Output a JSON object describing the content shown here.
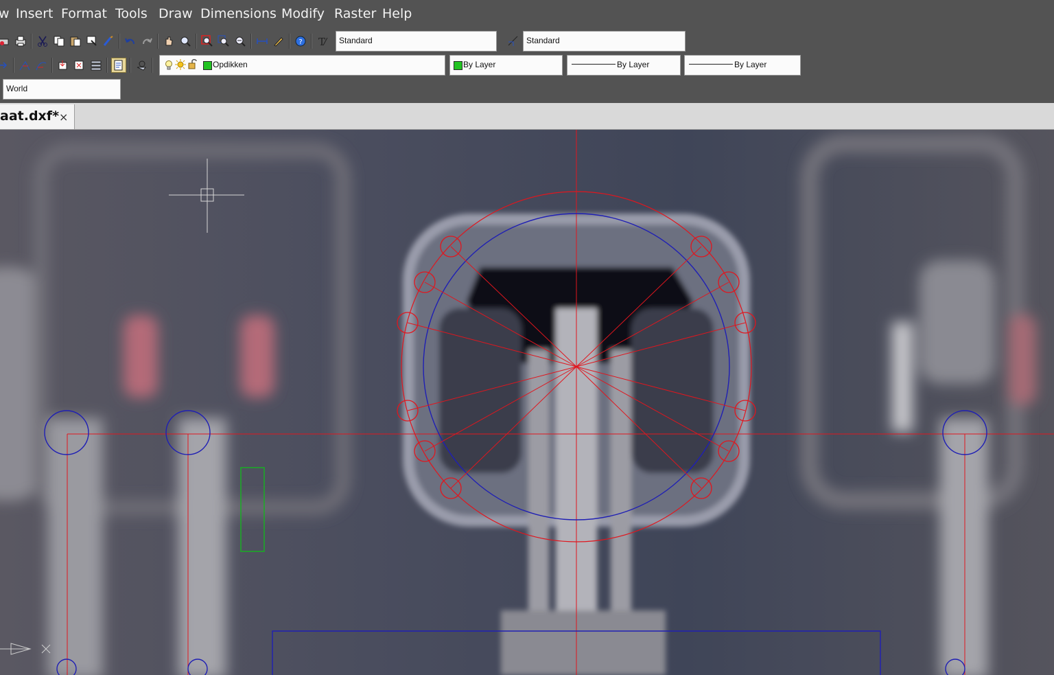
{
  "menu": {
    "items": [
      "w",
      "Insert",
      "Format",
      "Tools",
      "Draw",
      "Dimensions",
      "Modify",
      "Raster",
      "Help"
    ]
  },
  "toolbar": {
    "text_style": "Standard",
    "dim_style": "Standard",
    "layer": "Opdikken",
    "color": "By Layer",
    "linetype": "By Layer",
    "lineweight": "By Layer",
    "ucs": "World"
  },
  "colors": {
    "layer_swatch": "#22c322",
    "color_swatch": "#22c322",
    "drawing_red": "#e0161e",
    "drawing_blue": "#1f1fb4",
    "drawing_green": "#16b320"
  },
  "tabs": [
    {
      "label": "aat.dxf*",
      "close": "×"
    }
  ]
}
